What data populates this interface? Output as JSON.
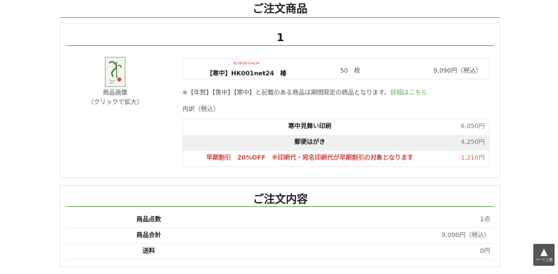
{
  "heading": {
    "title": "ご注文商品"
  },
  "order": {
    "number": "1",
    "image": {
      "icon": "greeting-card-thumbnail",
      "caption_line1": "商品画像",
      "caption_line2": "（クリックで拡大）"
    },
    "item": {
      "code": "ID:HK001net24",
      "name": "【寒中】HK001net24　椿",
      "quantity": "50　枚",
      "price": "9,090円（税込）"
    },
    "notice": {
      "text": "※【年賀】【喪中】【寒中】と記載のある商品は期間限定の商品となります。",
      "link": "詳細はこちら"
    },
    "breakdown_label": "内訳（税込）",
    "breakdown": [
      {
        "name": "寒中見舞い印刷",
        "amount": "6,050円"
      },
      {
        "name": "郵便はがき",
        "amount": "4,250円"
      },
      {
        "name": "早期割引　20%OFF　※印刷代・宛名印刷代が早期割引の対象となります",
        "amount": "-1,210円"
      }
    ]
  },
  "summary": {
    "title": "ご注文内容",
    "rows": [
      {
        "name": "商品点数",
        "value": "1点"
      },
      {
        "name": "商品合計",
        "value": "9,090円（税込）"
      },
      {
        "name": "送料",
        "value": "0円"
      }
    ]
  },
  "page_top": {
    "icon": "up-triangle-icon",
    "arrow": "▲",
    "label": "ページ上部"
  },
  "colors": {
    "accent": "#6aa84f",
    "discount": "#d0453f"
  }
}
